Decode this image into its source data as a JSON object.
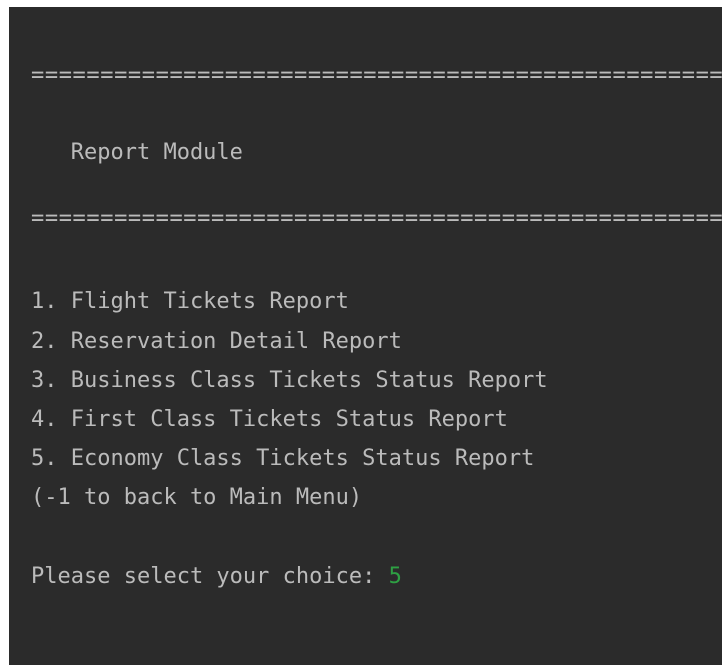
{
  "console": {
    "separator_top": "================================================================",
    "title": "   Report Module",
    "separator_bottom": "================================================================",
    "menu_items": [
      "1. Flight Tickets Report",
      "2. Reservation Detail Report",
      "3. Business Class Tickets Status Report",
      "4. First Class Tickets Status Report",
      "5. Economy Class Tickets Status Report",
      "(-1 to back to Main Menu)"
    ],
    "prompt": "Please select your choice: ",
    "input_value": "5"
  },
  "colors": {
    "background": "#2b2b2b",
    "text": "#bbbbbb",
    "input": "#2ea043"
  }
}
